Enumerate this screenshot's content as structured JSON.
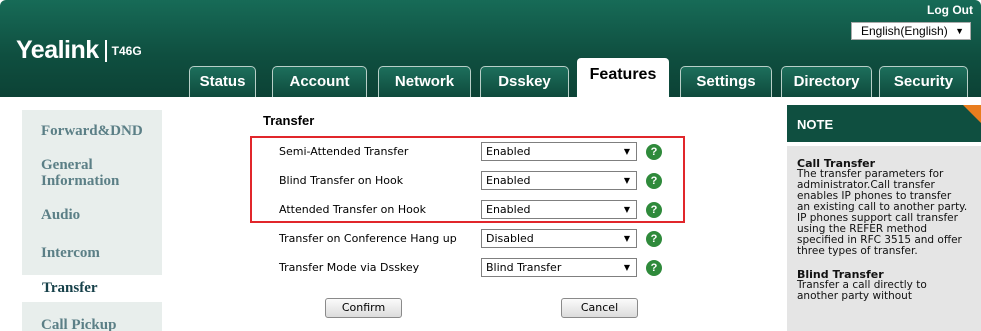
{
  "header": {
    "logo": "Yealink",
    "model": "T46G",
    "logout": "Log Out",
    "language": "English(English)"
  },
  "tabs": [
    "Status",
    "Account",
    "Network",
    "Dsskey",
    "Features",
    "Settings",
    "Directory",
    "Security"
  ],
  "active_tab": "Features",
  "sidebar": {
    "items": [
      {
        "label": "Forward&DND"
      },
      {
        "label": "General Information"
      },
      {
        "label": "Audio"
      },
      {
        "label": "Intercom"
      },
      {
        "label": "Transfer"
      },
      {
        "label": "Call Pickup"
      }
    ],
    "active": "Transfer"
  },
  "form": {
    "title": "Transfer",
    "rows": [
      {
        "label": "Semi-Attended Transfer",
        "value": "Enabled"
      },
      {
        "label": "Blind Transfer on Hook",
        "value": "Enabled"
      },
      {
        "label": "Attended Transfer on Hook",
        "value": "Enabled"
      },
      {
        "label": "Transfer on Conference Hang up",
        "value": "Disabled"
      },
      {
        "label": "Transfer Mode via Dsskey",
        "value": "Blind Transfer"
      }
    ],
    "help_glyph": "?",
    "confirm": "Confirm",
    "cancel": "Cancel"
  },
  "note": {
    "title": "NOTE",
    "call_transfer_heading": "Call Transfer",
    "call_transfer_lines": [
      "The transfer parameters for",
      "administrator.Call transfer",
      "enables IP phones to transfer",
      "an existing call to another party.",
      "IP phones support call transfer",
      "using the REFER method",
      "specified in RFC 3515 and offer",
      "three types of transfer."
    ],
    "blind_transfer_heading": "Blind Transfer",
    "blind_transfer_lines": [
      "Transfer a call directly to",
      "another party without"
    ]
  },
  "colors": {
    "header_green": "#0f4f40",
    "highlight_red": "#e1262b",
    "help_green": "#2f8a3b",
    "note_corner_orange": "#e97d1e"
  }
}
